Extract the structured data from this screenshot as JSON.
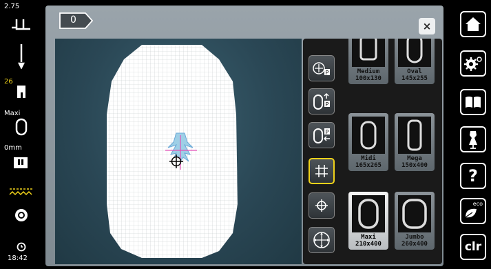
{
  "left_status": {
    "tension_value": "2.75",
    "stitch_count_label": "26",
    "hoop_label": "Maxi",
    "offset_label": "0mm",
    "clock": "18:42"
  },
  "header": {
    "tab_label": "0",
    "close_label": "×"
  },
  "hoops": [
    {
      "name": "Medium",
      "size": "100x130"
    },
    {
      "name": "Oval",
      "size": "145x255"
    },
    {
      "name": "Midi",
      "size": "165x265"
    },
    {
      "name": "Mega",
      "size": "150x400"
    },
    {
      "name": "Maxi",
      "size": "210x400"
    },
    {
      "name": "Jumbo",
      "size": "260x400"
    }
  ],
  "right_buttons": {
    "help_label": "?",
    "eco_label": "eco",
    "clr_label": "clr"
  },
  "colors": {
    "accent": "#f0d21a",
    "panel_bg": "#1a1a1a",
    "canvas_bg": "#2a4755"
  },
  "icons": [
    "home-icon",
    "settings-icon",
    "book-icon",
    "dress-form-icon",
    "help-icon",
    "eco-icon",
    "clear-icon",
    "center-point-icon",
    "move-up-icon",
    "move-left-icon",
    "grid-icon",
    "crosshair-icon",
    "center-needle-icon"
  ]
}
